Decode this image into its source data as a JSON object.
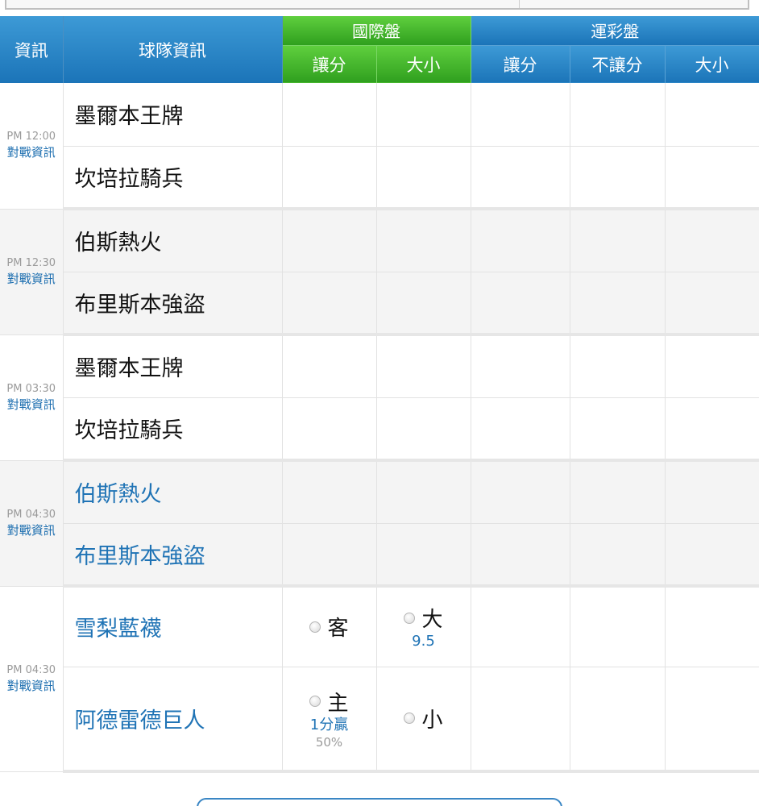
{
  "header": {
    "info": "資訊",
    "team": "球隊資訊",
    "intl_group": "國際盤",
    "lottery_group": "運彩盤",
    "intl_handicap": "讓分",
    "intl_total": "大小",
    "lot_handicap": "讓分",
    "lot_no_handicap": "不讓分",
    "lot_total": "大小"
  },
  "games": [
    {
      "time": "PM 12:00",
      "vs": "對戰資訊",
      "away": "墨爾本王牌",
      "home": "坎培拉騎兵"
    },
    {
      "time": "PM 12:30",
      "vs": "對戰資訊",
      "away": "伯斯熱火",
      "home": "布里斯本強盜"
    },
    {
      "time": "PM 03:30",
      "vs": "對戰資訊",
      "away": "墨爾本王牌",
      "home": "坎培拉騎兵"
    },
    {
      "time": "PM 04:30",
      "vs": "對戰資訊",
      "away": "伯斯熱火",
      "home": "布里斯本強盜"
    },
    {
      "time": "PM 04:30",
      "vs": "對戰資訊",
      "away": "雪梨藍襪",
      "home": "阿德雷德巨人",
      "odds": {
        "away_handicap": "客",
        "over": "大",
        "total_line": "9.5",
        "home_handicap": "主",
        "handicap_line": "1分贏",
        "handicap_pct": "50%",
        "under": "小"
      }
    }
  ],
  "colors": {
    "header_blue": "#1b74b8",
    "header_green": "#2f9f1e",
    "link_blue": "#1f73b5"
  }
}
